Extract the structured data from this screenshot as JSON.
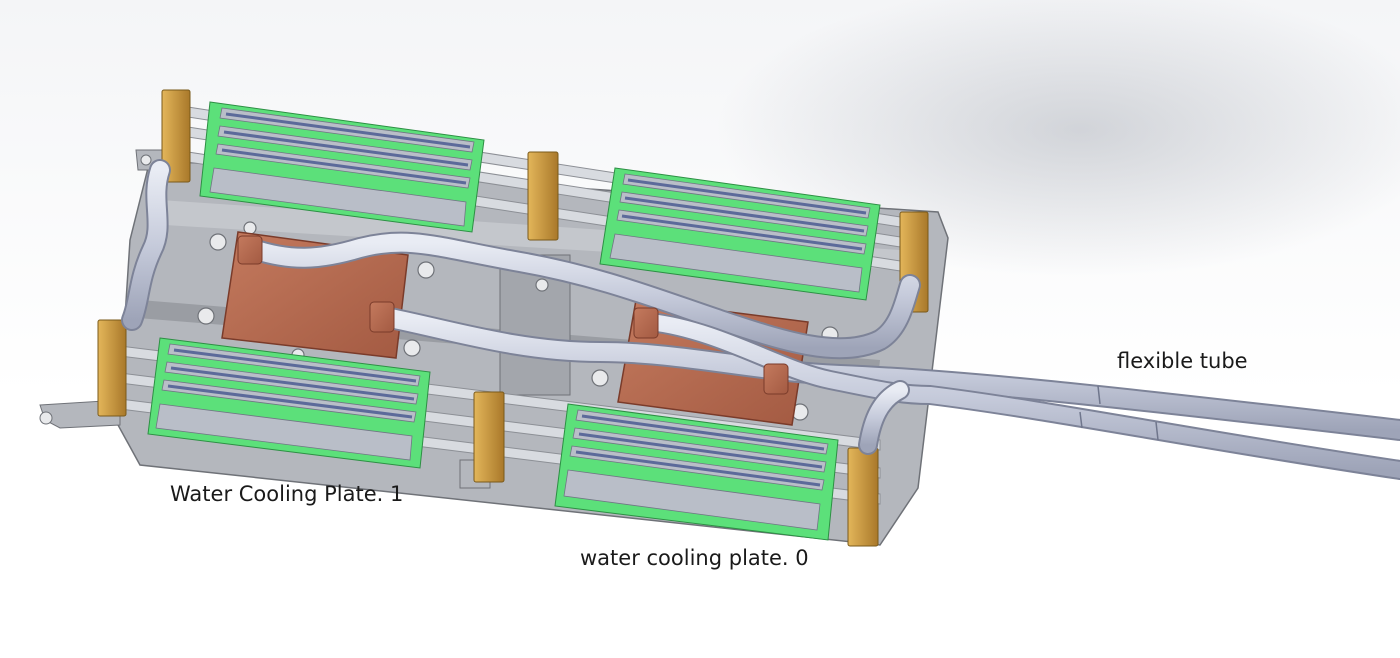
{
  "labels": {
    "plate_1": "Water Cooling Plate. 1",
    "plate_0": "water cooling plate. 0",
    "tube": "flexible tube"
  },
  "colors": {
    "frame": "#a7aab0",
    "rail": "#cfd2d7",
    "pcb": "#5ce07a",
    "memory_chip": "#b9bec8",
    "dimm_stripe": "#5c6a9a",
    "copper_plate": "#b8694f",
    "bracket": "#c89a3a",
    "tube": "#c9cedd"
  },
  "icons": [
    "cooling-assembly-illustration"
  ]
}
